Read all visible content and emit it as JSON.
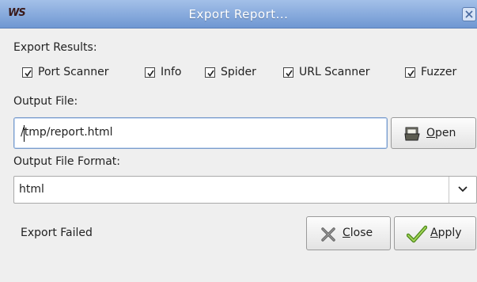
{
  "window": {
    "logo_text": "WS",
    "title": "Export Report..."
  },
  "export_results": {
    "label": "Export Results:",
    "options": [
      {
        "label": "Port Scanner",
        "checked": true
      },
      {
        "label": "Info",
        "checked": true
      },
      {
        "label": "Spider",
        "checked": true
      },
      {
        "label": "URL Scanner",
        "checked": true
      },
      {
        "label": "Fuzzer",
        "checked": true
      }
    ]
  },
  "output_file": {
    "label": "Output File:",
    "value": "/tmp/report.html",
    "open_button": {
      "mnemonic": "O",
      "rest": "pen"
    }
  },
  "output_format": {
    "label": "Output File Format:",
    "selected": "html"
  },
  "status": {
    "text": "Export Failed"
  },
  "buttons": {
    "close": {
      "mnemonic": "C",
      "rest": "lose"
    },
    "apply": {
      "mnemonic": "A",
      "rest": "pply"
    }
  }
}
